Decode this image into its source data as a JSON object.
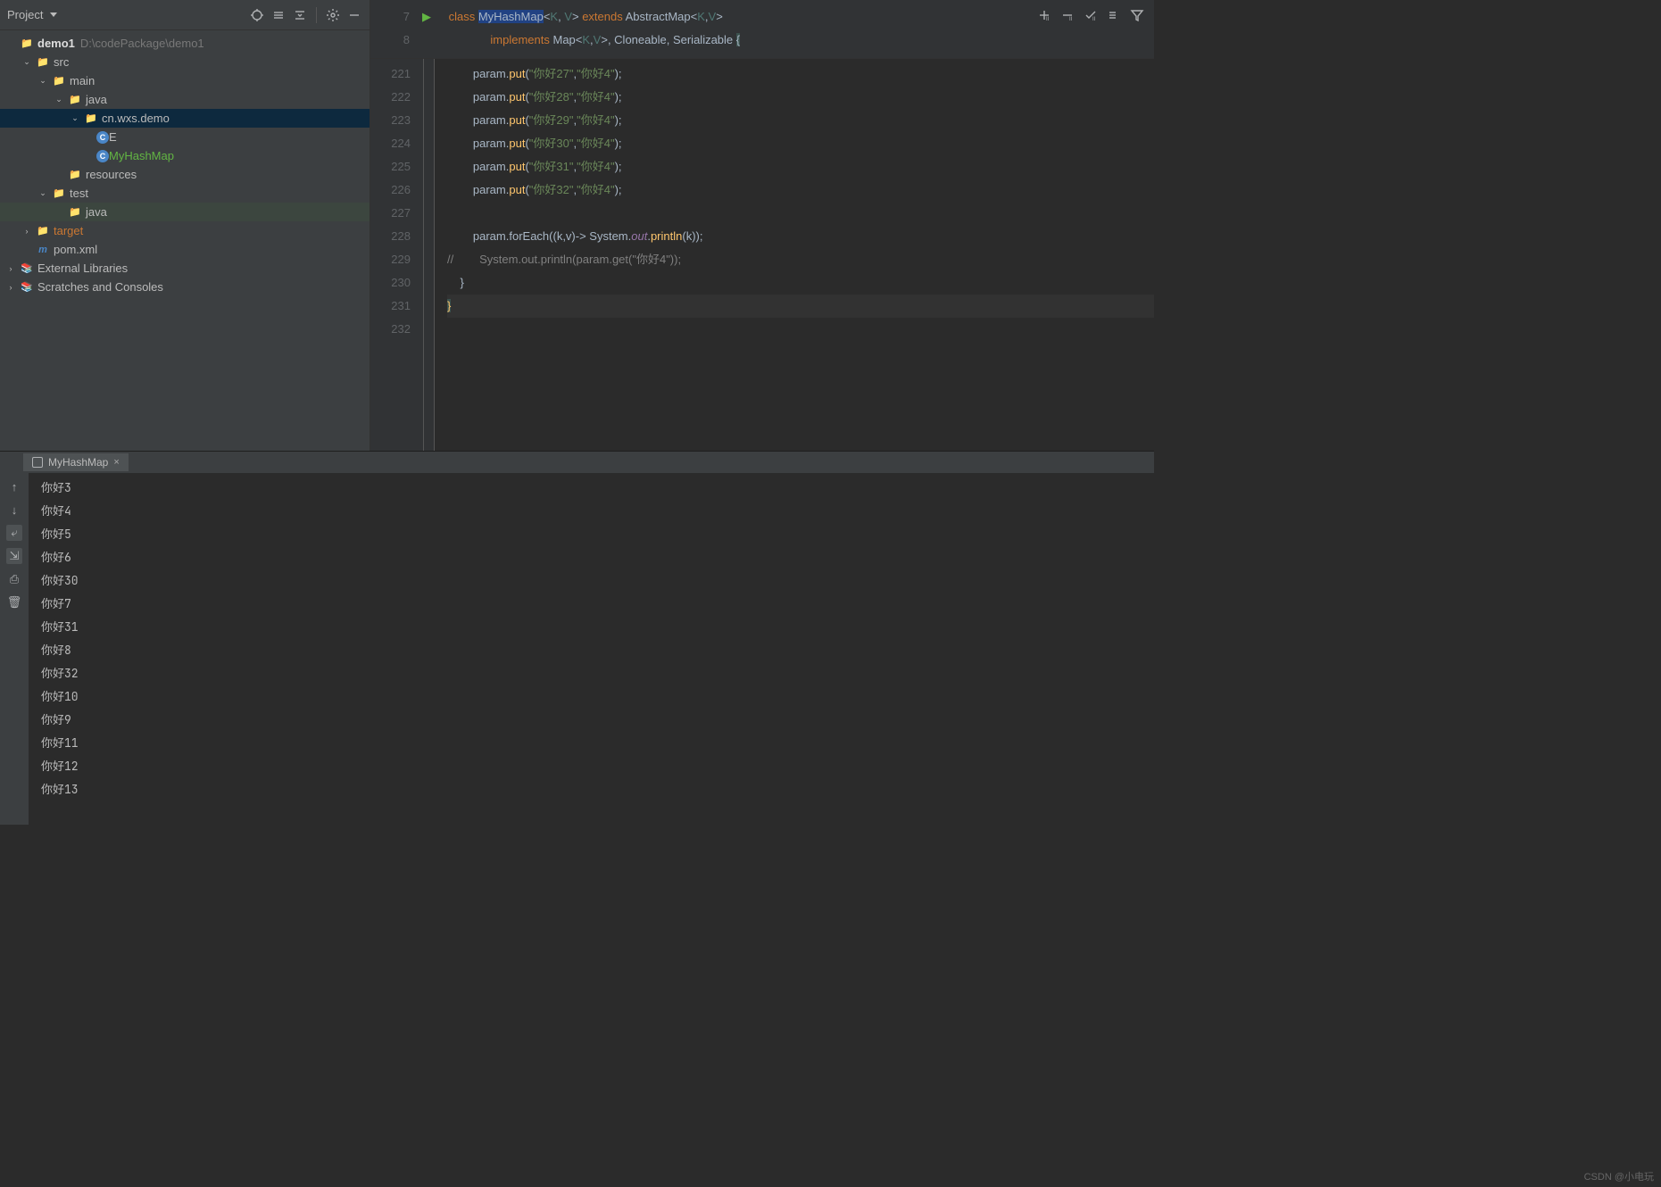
{
  "sidebar": {
    "title": "Project",
    "project_root": {
      "name": "demo1",
      "path": "D:\\codePackage\\demo1"
    },
    "tree": [
      {
        "label": "src",
        "depth": 1,
        "type": "folder",
        "arrow": "open"
      },
      {
        "label": "main",
        "depth": 2,
        "type": "folder",
        "arrow": "open"
      },
      {
        "label": "java",
        "depth": 3,
        "type": "folder-src",
        "arrow": "open"
      },
      {
        "label": "cn.wxs.demo",
        "depth": 4,
        "type": "package",
        "arrow": "open",
        "selected": true
      },
      {
        "label": "E",
        "depth": 5,
        "type": "class"
      },
      {
        "label": "MyHashMap",
        "depth": 5,
        "type": "class-green"
      },
      {
        "label": "resources",
        "depth": 3,
        "type": "folder-res"
      },
      {
        "label": "test",
        "depth": 2,
        "type": "folder",
        "arrow": "open"
      },
      {
        "label": "java",
        "depth": 3,
        "type": "folder-src",
        "highlight": true
      },
      {
        "label": "target",
        "depth": 1,
        "type": "folder-orange",
        "arrow": "closed"
      },
      {
        "label": "pom.xml",
        "depth": 1,
        "type": "maven"
      }
    ],
    "extras": [
      "External Libraries",
      "Scratches and Consoles"
    ]
  },
  "breadcrumb": {
    "line1_num": "7",
    "line2_num": "8",
    "tokens1": [
      "class ",
      "MyHashMap",
      "<",
      "K",
      ", ",
      "V",
      "> ",
      "extends ",
      "AbstractMap",
      "<",
      "K",
      ",",
      "V",
      ">"
    ],
    "tokens2": [
      "implements ",
      "Map",
      "<",
      "K",
      ",",
      "V",
      ">",
      ", ",
      "Cloneable",
      ", ",
      "Serializable ",
      " {"
    ]
  },
  "code": {
    "start": 221,
    "lines": [
      {
        "n": 221,
        "indent": "        ",
        "pre": "param.",
        "fn": "put",
        "open": "(",
        "s1": "\"你好27\"",
        "c": ",",
        "s2": "\"你好4\"",
        "end": ");"
      },
      {
        "n": 222,
        "indent": "        ",
        "pre": "param.",
        "fn": "put",
        "open": "(",
        "s1": "\"你好28\"",
        "c": ",",
        "s2": "\"你好4\"",
        "end": ");"
      },
      {
        "n": 223,
        "indent": "        ",
        "pre": "param.",
        "fn": "put",
        "open": "(",
        "s1": "\"你好29\"",
        "c": ",",
        "s2": "\"你好4\"",
        "end": ");"
      },
      {
        "n": 224,
        "indent": "        ",
        "pre": "param.",
        "fn": "put",
        "open": "(",
        "s1": "\"你好30\"",
        "c": ",",
        "s2": "\"你好4\"",
        "end": ");"
      },
      {
        "n": 225,
        "indent": "        ",
        "pre": "param.",
        "fn": "put",
        "open": "(",
        "s1": "\"你好31\"",
        "c": ",",
        "s2": "\"你好4\"",
        "end": ");"
      },
      {
        "n": 226,
        "indent": "        ",
        "pre": "param.",
        "fn": "put",
        "open": "(",
        "s1": "\"你好32\"",
        "c": ",",
        "s2": "\"你好4\"",
        "end": ");"
      },
      {
        "n": 227,
        "blank": true
      },
      {
        "n": 228,
        "foreach": true,
        "indent": "        ",
        "text": "param.forEach((k,v)-> System.",
        "it": "out",
        ".": ".",
        "fn": "println",
        "args": "(k));"
      },
      {
        "n": 229,
        "comment": true,
        "indent": "",
        "text": "//        System.out.println(param.get(\"你好4\"));"
      },
      {
        "n": 230,
        "close1": true,
        "text": "    }"
      },
      {
        "n": 231,
        "close2": true,
        "text": "}"
      },
      {
        "n": 232,
        "blank": true
      }
    ]
  },
  "console_tab": "MyHashMap",
  "console": [
    "你好3",
    "你好4",
    "你好5",
    "你好6",
    "你好30",
    "你好7",
    "你好31",
    "你好8",
    "你好32",
    "你好10",
    "你好9",
    "你好11",
    "你好12",
    "你好13"
  ],
  "watermark": "CSDN @小电玩"
}
